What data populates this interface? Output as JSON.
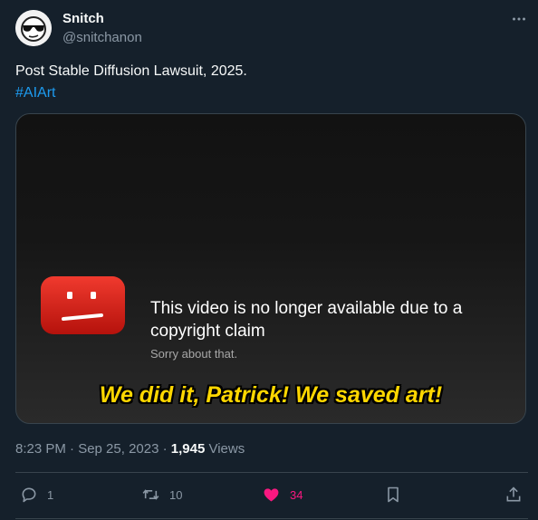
{
  "tweet": {
    "author": {
      "name": "Snitch",
      "handle": "@snitchanon",
      "avatar_icon": "sunglasses-face-avatar"
    },
    "text_line1": "Post Stable Diffusion Lawsuit, 2025.",
    "hashtag": "#AIArt",
    "media": {
      "icon": "youtube-sad-logo",
      "unavailable_message": "This video is no longer available due to a copyright claim",
      "sub_message": "Sorry about that.",
      "caption": "We did it, Patrick! We saved art!"
    },
    "timestamp": "8:23 PM · Sep 25, 2023 · ",
    "views_count": "1,945",
    "views_label": " Views",
    "actions": {
      "replies": "1",
      "reposts": "10",
      "likes": "34",
      "liked": true
    },
    "colors": {
      "background": "#15202b",
      "accent": "#1d9bf0",
      "like": "#f91880",
      "caption": "#ffd700",
      "youtube_red": "#e62117"
    }
  }
}
